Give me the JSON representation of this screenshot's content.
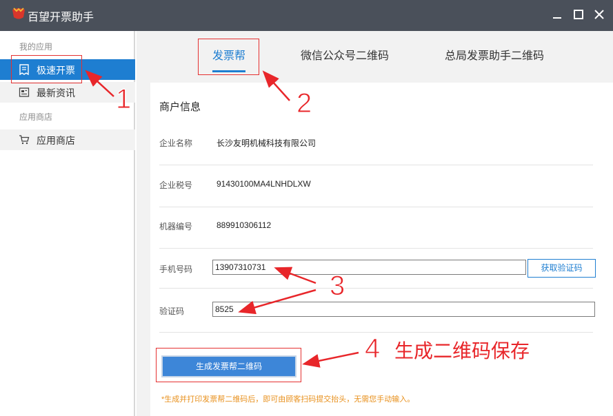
{
  "window": {
    "title": "百望开票助手",
    "controls": [
      "minimize",
      "maximize",
      "close"
    ]
  },
  "sidebar": {
    "groups": [
      {
        "label": "我的应用",
        "items": [
          {
            "label": "极速开票",
            "icon": "invoice-icon",
            "active": true
          },
          {
            "label": "最新资讯",
            "icon": "news-icon",
            "active": false
          }
        ]
      },
      {
        "label": "应用商店",
        "items": [
          {
            "label": "应用商店",
            "icon": "cart-icon",
            "active": false
          }
        ]
      }
    ]
  },
  "tabs": [
    {
      "label": "发票帮",
      "active": true
    },
    {
      "label": "微信公众号二维码",
      "active": false
    },
    {
      "label": "总局发票助手二维码",
      "active": false
    }
  ],
  "merchant": {
    "section_title": "商户信息",
    "company_label": "企业名称",
    "company_value": "长沙友明机械科技有限公司",
    "tax_label": "企业税号",
    "tax_value": "91430100MA4LNHDLXW",
    "machine_label": "机器编号",
    "machine_value": "889910306112",
    "phone_label": "手机号码",
    "phone_value": "13907310731",
    "code_label": "验证码",
    "code_value": "8525",
    "get_code_button": "获取验证码",
    "generate_button": "生成发票帮二维码",
    "tip": "*生成并打印发票帮二维码后，即可由顾客扫码提交抬头，无需您手动输入。"
  },
  "annotations": {
    "step1": "1",
    "step2": "2",
    "step3": "3",
    "step4": "4",
    "step4_text": "生成二维码保存",
    "color": "#e8262a"
  },
  "colors": {
    "accent": "#1e7ed1",
    "titlebar": "#4a505a",
    "tip": "#e8901c"
  }
}
